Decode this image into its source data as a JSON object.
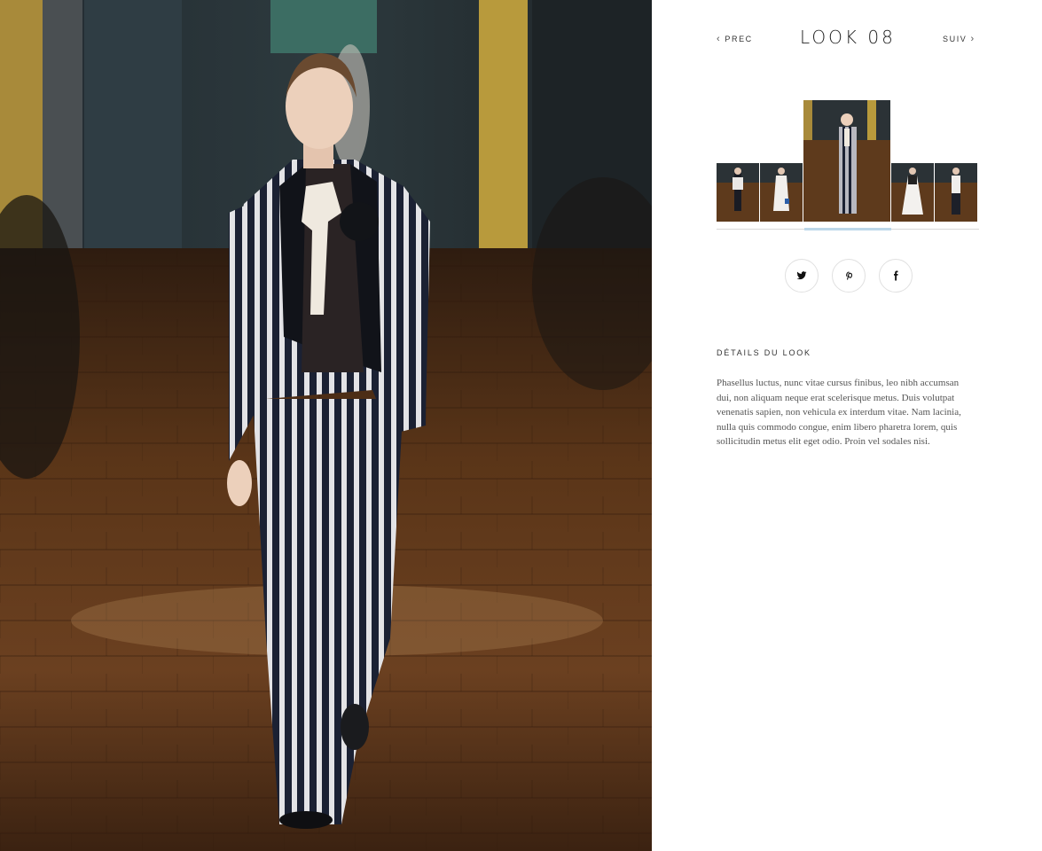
{
  "navigation": {
    "prev_label": "PREC",
    "next_label": "SUIV",
    "prev_icon": "chevron-left-icon",
    "next_icon": "chevron-right-icon",
    "look_title": "LOOK 08"
  },
  "thumbnails": {
    "count": 5,
    "active_index": 2,
    "active_underline_color": "#bcd7e9"
  },
  "social": [
    {
      "name": "twitter",
      "icon": "twitter-icon"
    },
    {
      "name": "pinterest",
      "icon": "pinterest-icon"
    },
    {
      "name": "facebook",
      "icon": "facebook-icon"
    }
  ],
  "details": {
    "heading": "DÉTAILS DU  LOOK",
    "text": "Phasellus luctus, nunc vitae cursus finibus, leo nibh accumsan dui, non aliquam neque erat scelerisque metus. Duis volutpat venenatis sapien, non vehicula ex interdum vitae. Nam lacinia, nulla quis commodo congue, enim libero pharetra lorem, quis sollicitudin metus elit eget odio. Proin vel sodales nisi."
  },
  "colors": {
    "floor": "#5a3518",
    "wall_gold": "#b8963a",
    "stripe_dark": "#1e2233",
    "stripe_light": "#d9d9d9"
  }
}
